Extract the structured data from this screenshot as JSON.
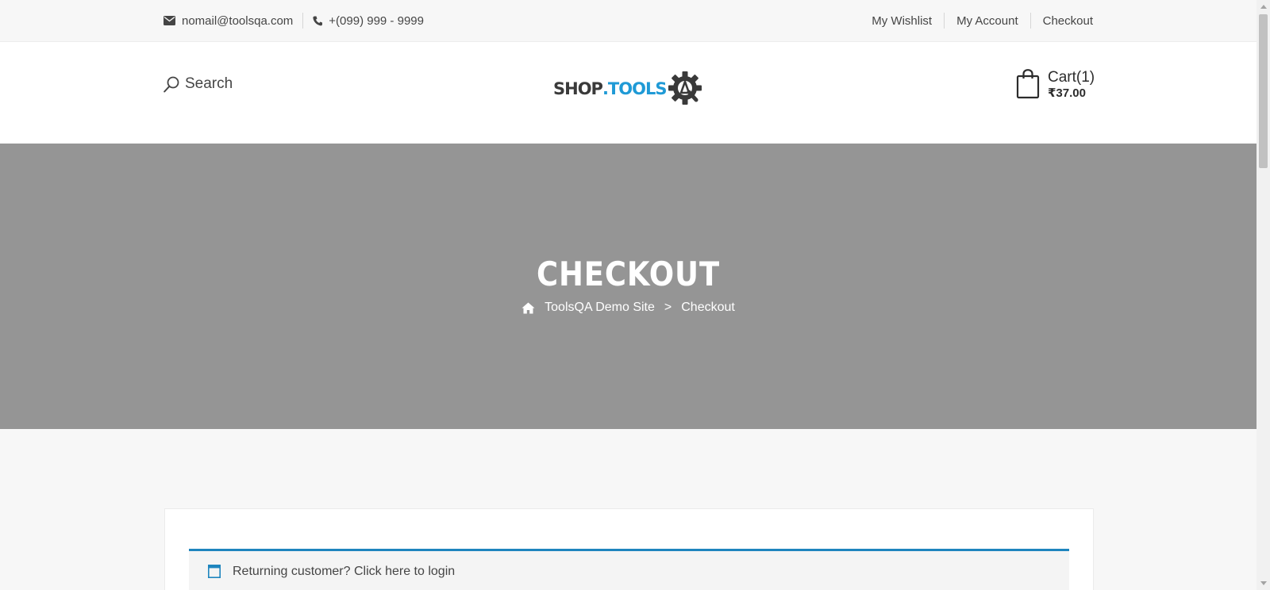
{
  "topbar": {
    "email": "nomail@toolsqa.com",
    "phone": "+(099) 999 - 9999",
    "links": [
      "My Wishlist",
      "My Account",
      "Checkout"
    ]
  },
  "header": {
    "search_label": "Search",
    "logo": {
      "part1": "SHOP",
      "part2": ".TOOLS"
    },
    "cart": {
      "label": "Cart(1)",
      "total": "₹37.00"
    }
  },
  "hero": {
    "title": "CHECKOUT",
    "breadcrumb": {
      "home": "ToolsQA Demo Site",
      "separator": ">",
      "current": "Checkout"
    }
  },
  "notice": {
    "text": "Returning customer?",
    "link": "Click here to login"
  },
  "colors": {
    "accent": "#1e85be",
    "logo_blue": "#1f9ad6",
    "hero_bg": "#959595"
  },
  "icons": [
    "envelope-icon",
    "phone-icon",
    "search-icon",
    "gear-logo-icon",
    "shopping-bag-icon",
    "home-icon",
    "window-icon"
  ]
}
